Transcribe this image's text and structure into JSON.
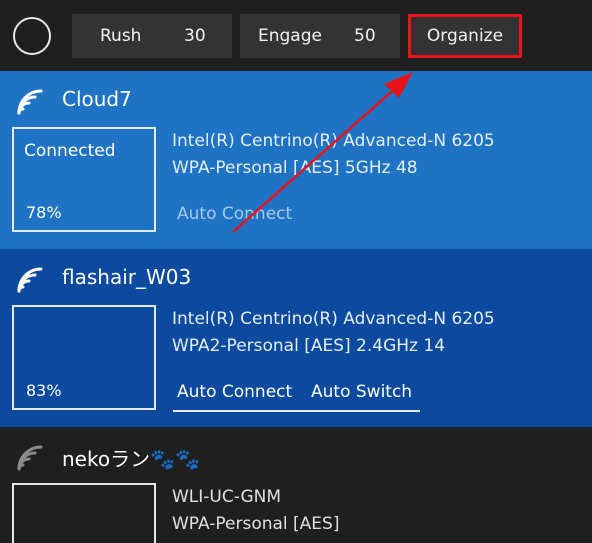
{
  "toolbar": {
    "rush": {
      "label": "Rush",
      "value": "30"
    },
    "engage": {
      "label": "Engage",
      "value": "50"
    },
    "organize": {
      "label": "Organize"
    }
  },
  "networks": [
    {
      "ssid": "Cloud7",
      "status": "Connected",
      "signal": "78%",
      "adapter": "Intel(R) Centrino(R) Advanced-N 6205",
      "security": "WPA-Personal [AES] 5GHz 48",
      "auto_connect": "Auto Connect",
      "color": "#1e73c4"
    },
    {
      "ssid": "flashair_W03",
      "signal": "83%",
      "adapter": "Intel(R) Centrino(R) Advanced-N 6205",
      "security": "WPA2-Personal [AES] 2.4GHz 14",
      "auto_connect": "Auto Connect",
      "auto_switch": "Auto Switch",
      "color": "#0c4aa0"
    },
    {
      "ssid": "nekoラン🐾🐾",
      "adapter": "WLI-UC-GNM",
      "security": "WPA-Personal [AES]",
      "color": "#1f1f1f"
    }
  ],
  "annotation": {
    "highlight_color": "#e8141a",
    "icon": "red-arrow-icon"
  }
}
